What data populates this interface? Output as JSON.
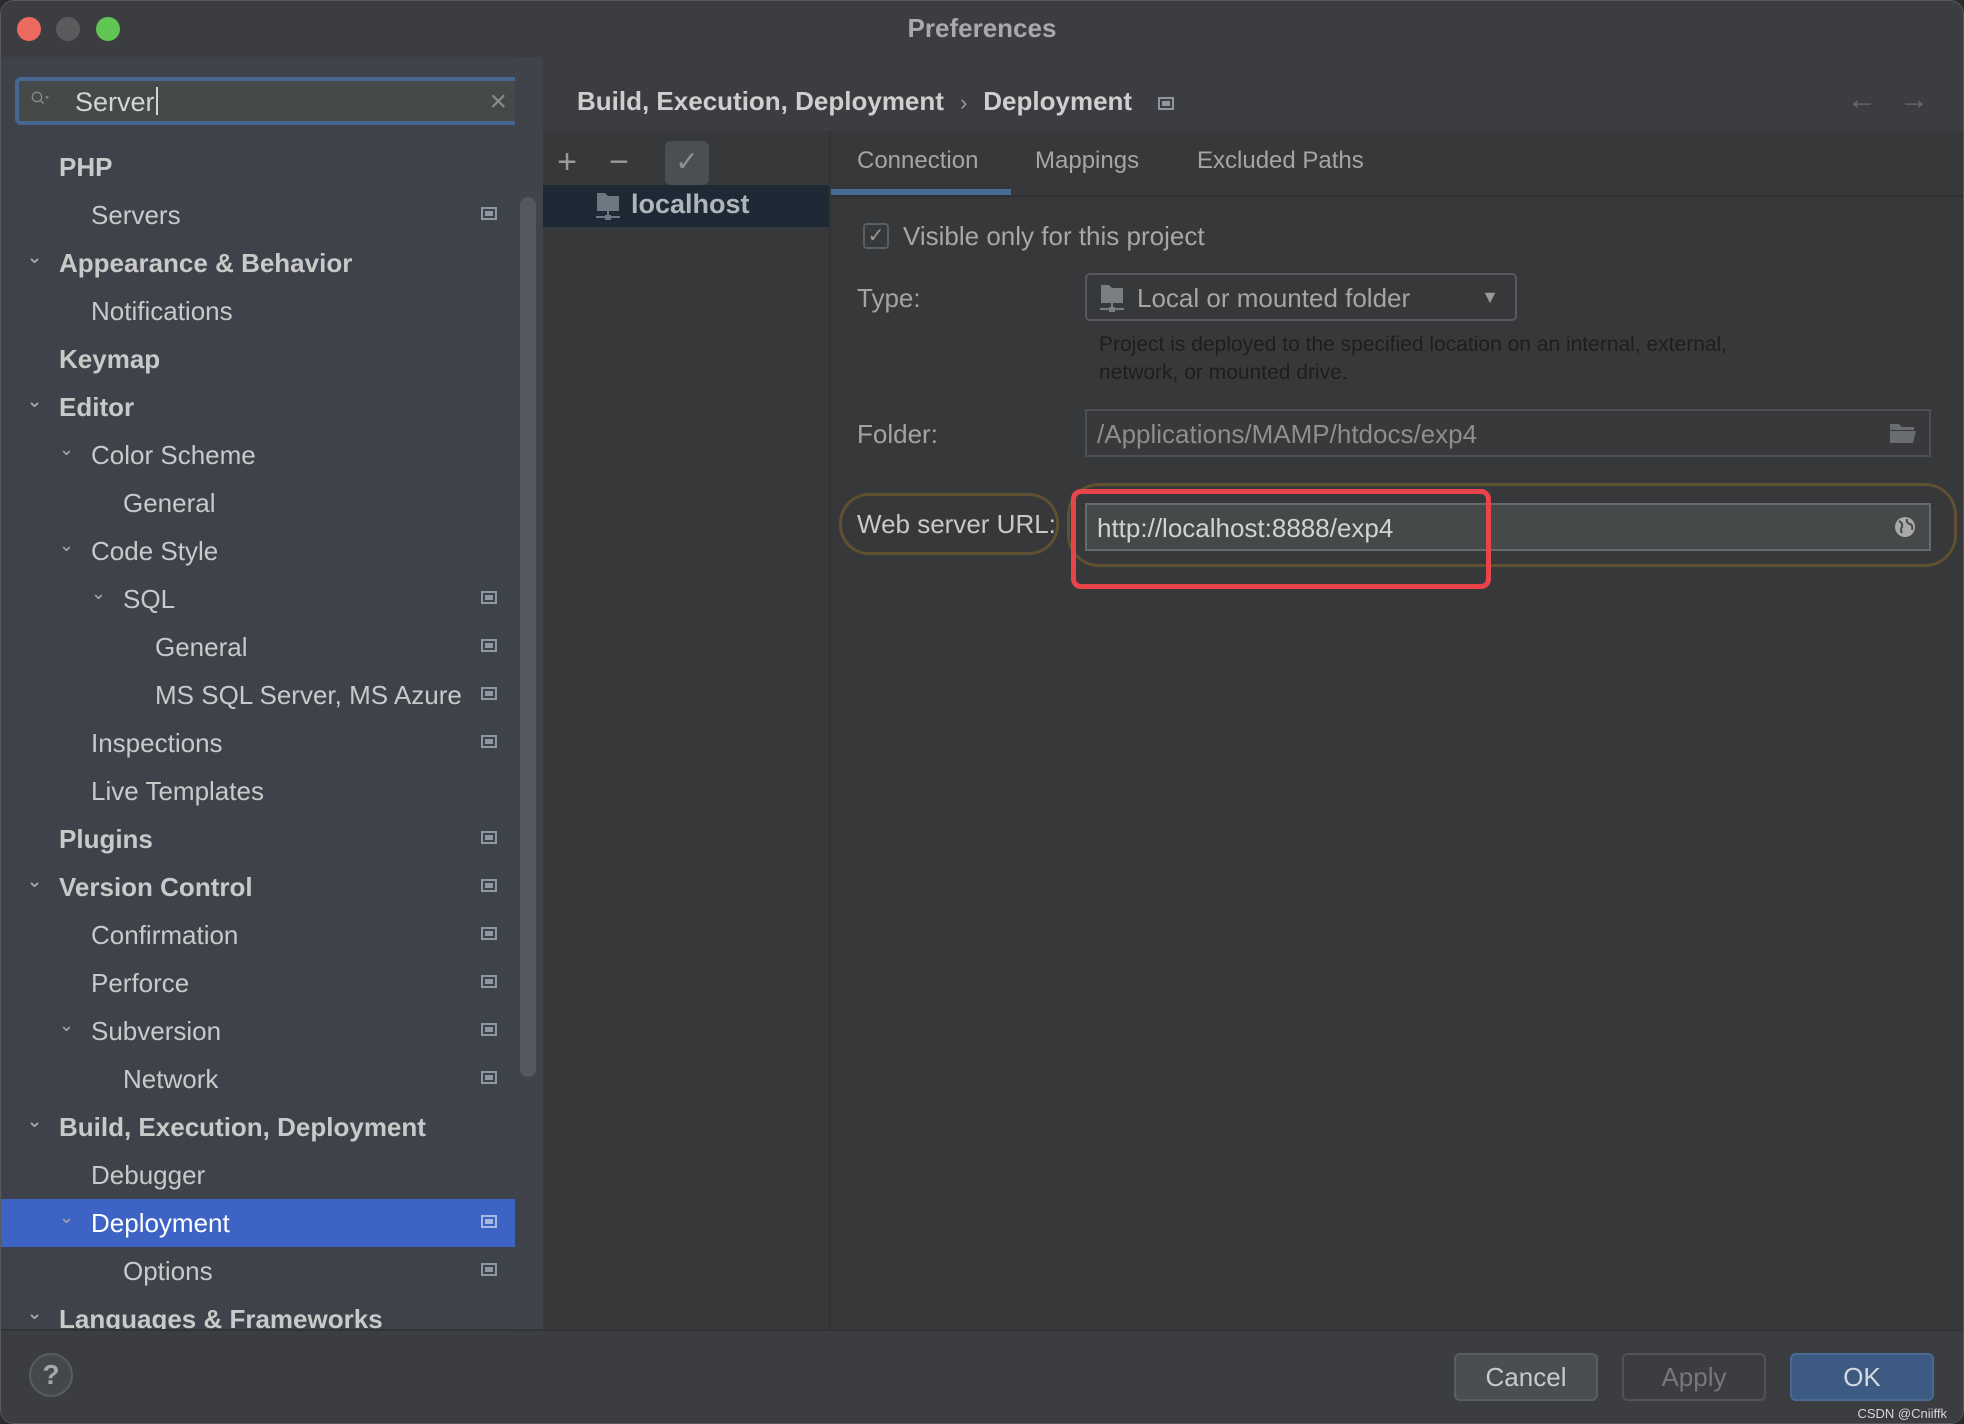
{
  "window": {
    "title": "Preferences"
  },
  "search": {
    "value": "Server",
    "clear_icon": "×"
  },
  "sidebar": {
    "items": [
      {
        "label": "PHP",
        "level": 0,
        "bold": true,
        "expandable": false,
        "project_icon": false
      },
      {
        "label": "Servers",
        "level": 1,
        "bold": false,
        "expandable": false,
        "project_icon": true
      },
      {
        "label": "Appearance & Behavior",
        "level": 0,
        "bold": true,
        "expandable": true,
        "project_icon": false
      },
      {
        "label": "Notifications",
        "level": 1,
        "bold": false,
        "expandable": false,
        "project_icon": false
      },
      {
        "label": "Keymap",
        "level": 0,
        "bold": true,
        "expandable": false,
        "project_icon": false
      },
      {
        "label": "Editor",
        "level": 0,
        "bold": true,
        "expandable": true,
        "project_icon": false
      },
      {
        "label": "Color Scheme",
        "level": 1,
        "bold": false,
        "expandable": true,
        "project_icon": false
      },
      {
        "label": "General",
        "level": 2,
        "bold": false,
        "expandable": false,
        "project_icon": false
      },
      {
        "label": "Code Style",
        "level": 1,
        "bold": false,
        "expandable": true,
        "project_icon": false
      },
      {
        "label": "SQL",
        "level": 2,
        "bold": false,
        "expandable": true,
        "project_icon": true
      },
      {
        "label": "General",
        "level": 3,
        "bold": false,
        "expandable": false,
        "project_icon": true
      },
      {
        "label": "MS SQL Server, MS Azure",
        "level": 3,
        "bold": false,
        "expandable": false,
        "project_icon": true
      },
      {
        "label": "Inspections",
        "level": 1,
        "bold": false,
        "expandable": false,
        "project_icon": true
      },
      {
        "label": "Live Templates",
        "level": 1,
        "bold": false,
        "expandable": false,
        "project_icon": false
      },
      {
        "label": "Plugins",
        "level": 0,
        "bold": true,
        "expandable": false,
        "project_icon": true
      },
      {
        "label": "Version Control",
        "level": 0,
        "bold": true,
        "expandable": true,
        "project_icon": true
      },
      {
        "label": "Confirmation",
        "level": 1,
        "bold": false,
        "expandable": false,
        "project_icon": true
      },
      {
        "label": "Perforce",
        "level": 1,
        "bold": false,
        "expandable": false,
        "project_icon": true
      },
      {
        "label": "Subversion",
        "level": 1,
        "bold": false,
        "expandable": true,
        "project_icon": true
      },
      {
        "label": "Network",
        "level": 2,
        "bold": false,
        "expandable": false,
        "project_icon": true
      },
      {
        "label": "Build, Execution, Deployment",
        "level": 0,
        "bold": true,
        "expandable": true,
        "project_icon": false
      },
      {
        "label": "Debugger",
        "level": 1,
        "bold": false,
        "expandable": false,
        "project_icon": false
      },
      {
        "label": "Deployment",
        "level": 1,
        "bold": false,
        "expandable": true,
        "project_icon": true,
        "selected": true
      },
      {
        "label": "Options",
        "level": 2,
        "bold": false,
        "expandable": false,
        "project_icon": true
      },
      {
        "label": "Languages & Frameworks",
        "level": 0,
        "bold": true,
        "expandable": true,
        "project_icon": false
      }
    ]
  },
  "breadcrumb": {
    "parent": "Build, Execution, Deployment",
    "separator": "›",
    "current": "Deployment"
  },
  "nav": {
    "back": "←",
    "forward": "→"
  },
  "servers_toolbar": {
    "add": "+",
    "remove": "−",
    "default": "✓"
  },
  "servers": [
    {
      "name": "localhost",
      "selected": true
    }
  ],
  "tabs": [
    {
      "label": "Connection",
      "active": true
    },
    {
      "label": "Mappings",
      "active": false
    },
    {
      "label": "Excluded Paths",
      "active": false
    }
  ],
  "connection": {
    "visible_only_label": "Visible only for this project",
    "visible_only_checked": true,
    "check_mark": "✓",
    "type_label": "Type:",
    "type_value": "Local or mounted folder",
    "type_description": "Project is deployed to the specified location on an internal, external, network, or mounted drive.",
    "folder_label": "Folder:",
    "folder_value": "/Applications/MAMP/htdocs/exp4",
    "web_url_label": "Web server URL:",
    "web_url_value": "http://localhost:8888/exp4"
  },
  "footer": {
    "help": "?",
    "cancel": "Cancel",
    "apply": "Apply",
    "ok": "OK"
  },
  "watermark": "CSDN @Cniiffk",
  "colors": {
    "selection": "#3d64c5",
    "highlight_box": "#e9444a",
    "ok_button": "#3d5a82",
    "focus_border": "#46678f"
  }
}
